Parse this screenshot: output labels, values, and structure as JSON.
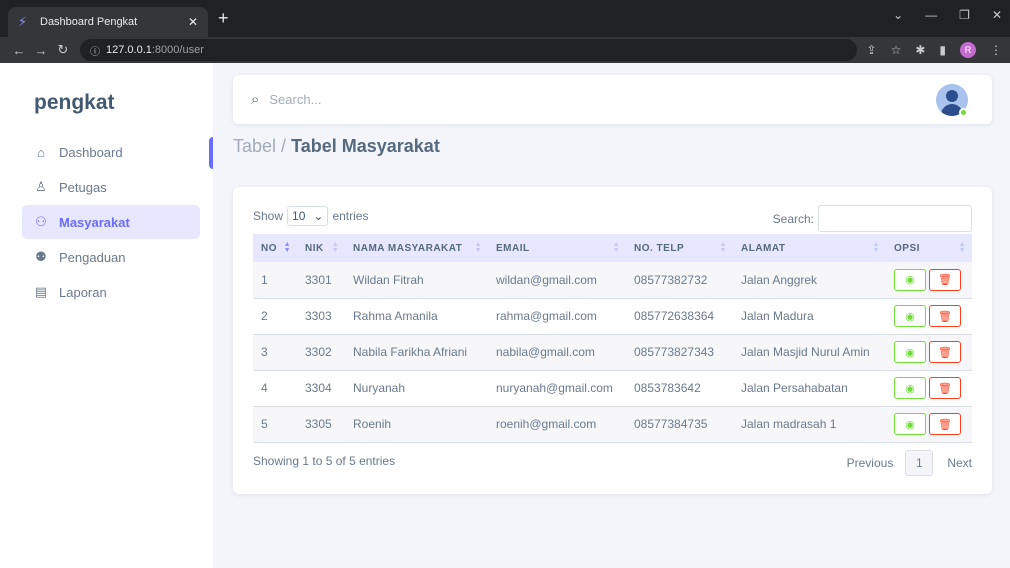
{
  "browser": {
    "tab_title": "Dashboard Pengkat",
    "url_host": "127.0.0.1",
    "url_path": ":8000/user",
    "profile_initial": "R"
  },
  "sidebar": {
    "brand": "pengkat",
    "items": [
      {
        "label": "Dashboard",
        "icon": "home-icon"
      },
      {
        "label": "Petugas",
        "icon": "user-icon"
      },
      {
        "label": "Masyarakat",
        "icon": "users-icon",
        "active": true
      },
      {
        "label": "Pengaduan",
        "icon": "user-voice-icon"
      },
      {
        "label": "Laporan",
        "icon": "file-icon"
      }
    ]
  },
  "navbar": {
    "search_placeholder": "Search..."
  },
  "breadcrumb": {
    "parent": "Tabel /",
    "current": "Tabel Masyarakat"
  },
  "table": {
    "show_label": "Show",
    "entries_value": "10",
    "entries_label": "entries",
    "search_label": "Search:",
    "columns": [
      "NO",
      "NIK",
      "NAMA MASYARAKAT",
      "EMAIL",
      "NO. TELP",
      "ALAMAT",
      "OPSI"
    ],
    "rows": [
      [
        "1",
        "3301",
        "Wildan Fitrah",
        "wildan@gmail.com",
        "08577382732",
        "Jalan Anggrek"
      ],
      [
        "2",
        "3303",
        "Rahma Amanila",
        "rahma@gmail.com",
        "085772638364",
        "Jalan Madura"
      ],
      [
        "3",
        "3302",
        "Nabila Farikha Afriani",
        "nabila@gmail.com",
        "085773827343",
        "Jalan Masjid Nurul Amin"
      ],
      [
        "4",
        "3304",
        "Nuryanah",
        "nuryanah@gmail.com",
        "0853783642",
        "Jalan Persahabatan"
      ],
      [
        "5",
        "3305",
        "Roenih",
        "roenih@gmail.com",
        "08577384735",
        "Jalan madrasah 1"
      ]
    ],
    "info": "Showing 1 to 5 of 5 entries",
    "prev_label": "Previous",
    "page_number": "1",
    "next_label": "Next"
  },
  "colors": {
    "primary": "#696cff",
    "success": "#71dd37",
    "danger": "#ff3e1d"
  }
}
